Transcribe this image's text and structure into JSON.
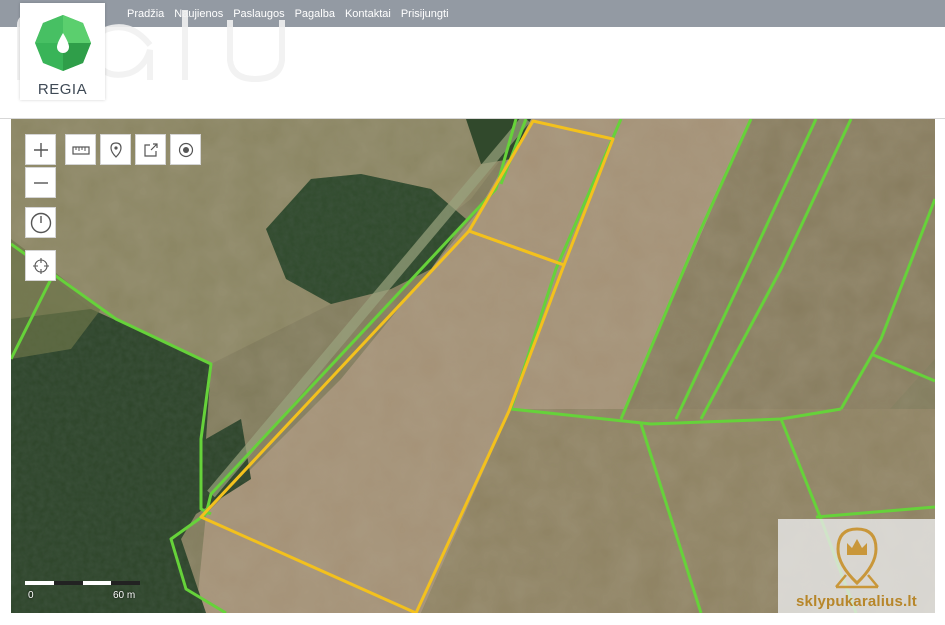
{
  "nav": {
    "items": [
      {
        "label": "Pradžia"
      },
      {
        "label": "Naujienos"
      },
      {
        "label": "Paslaugos"
      },
      {
        "label": "Pagalba"
      },
      {
        "label": "Kontaktai"
      },
      {
        "label": "Prisijungti"
      }
    ]
  },
  "logo": {
    "text": "REGIA",
    "watermark_text": "ralu"
  },
  "map": {
    "controls": [
      {
        "icon": "plus-icon",
        "action": "zoom-in"
      },
      {
        "icon": "minus-icon",
        "action": "zoom-out"
      },
      {
        "icon": "ruler-icon",
        "action": "measure-distance"
      },
      {
        "icon": "pin-icon",
        "action": "place-marker"
      },
      {
        "icon": "share-icon",
        "action": "share"
      },
      {
        "icon": "target-icon",
        "action": "locate"
      },
      {
        "icon": "clock-icon",
        "action": "history"
      },
      {
        "icon": "crosshair-icon",
        "action": "coordinates"
      }
    ],
    "scale": {
      "start_label": "0",
      "end_label": "60 m"
    },
    "colors": {
      "parcel_boundary": "#66d23a",
      "selected_parcel": "#f3c11d",
      "field": "#a08e75",
      "forest": "#2b4127"
    }
  },
  "watermark_badge": {
    "text": "sklypukaralius.lt",
    "icon": "crown-pin-icon"
  }
}
